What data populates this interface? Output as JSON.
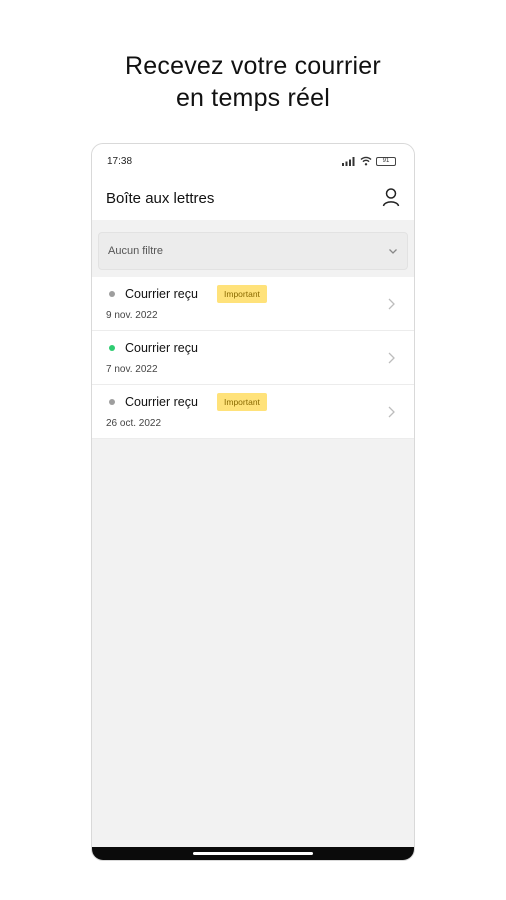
{
  "headline": {
    "line1": "Recevez votre courrier",
    "line2": "en temps réel"
  },
  "status_bar": {
    "time": "17:38",
    "battery": "91"
  },
  "app_bar": {
    "title": "Boîte aux lettres",
    "profile_icon": "person-icon"
  },
  "filter": {
    "value": "Aucun filtre",
    "icon": "chevron-down-icon"
  },
  "mail_items": [
    {
      "title": "Courrier reçu",
      "date": "9 nov. 2022",
      "badge": "Important",
      "status_color": "#9e9e9e"
    },
    {
      "title": "Courrier reçu",
      "date": "7 nov. 2022",
      "badge": "",
      "status_color": "#2ecc71"
    },
    {
      "title": "Courrier reçu",
      "date": "26 oct. 2022",
      "badge": "Important",
      "status_color": "#9e9e9e"
    }
  ],
  "colors": {
    "accent_badge": "#ffe27a",
    "unread_dot": "#2ecc71",
    "read_dot": "#9e9e9e",
    "background": "#f2f2f2"
  }
}
